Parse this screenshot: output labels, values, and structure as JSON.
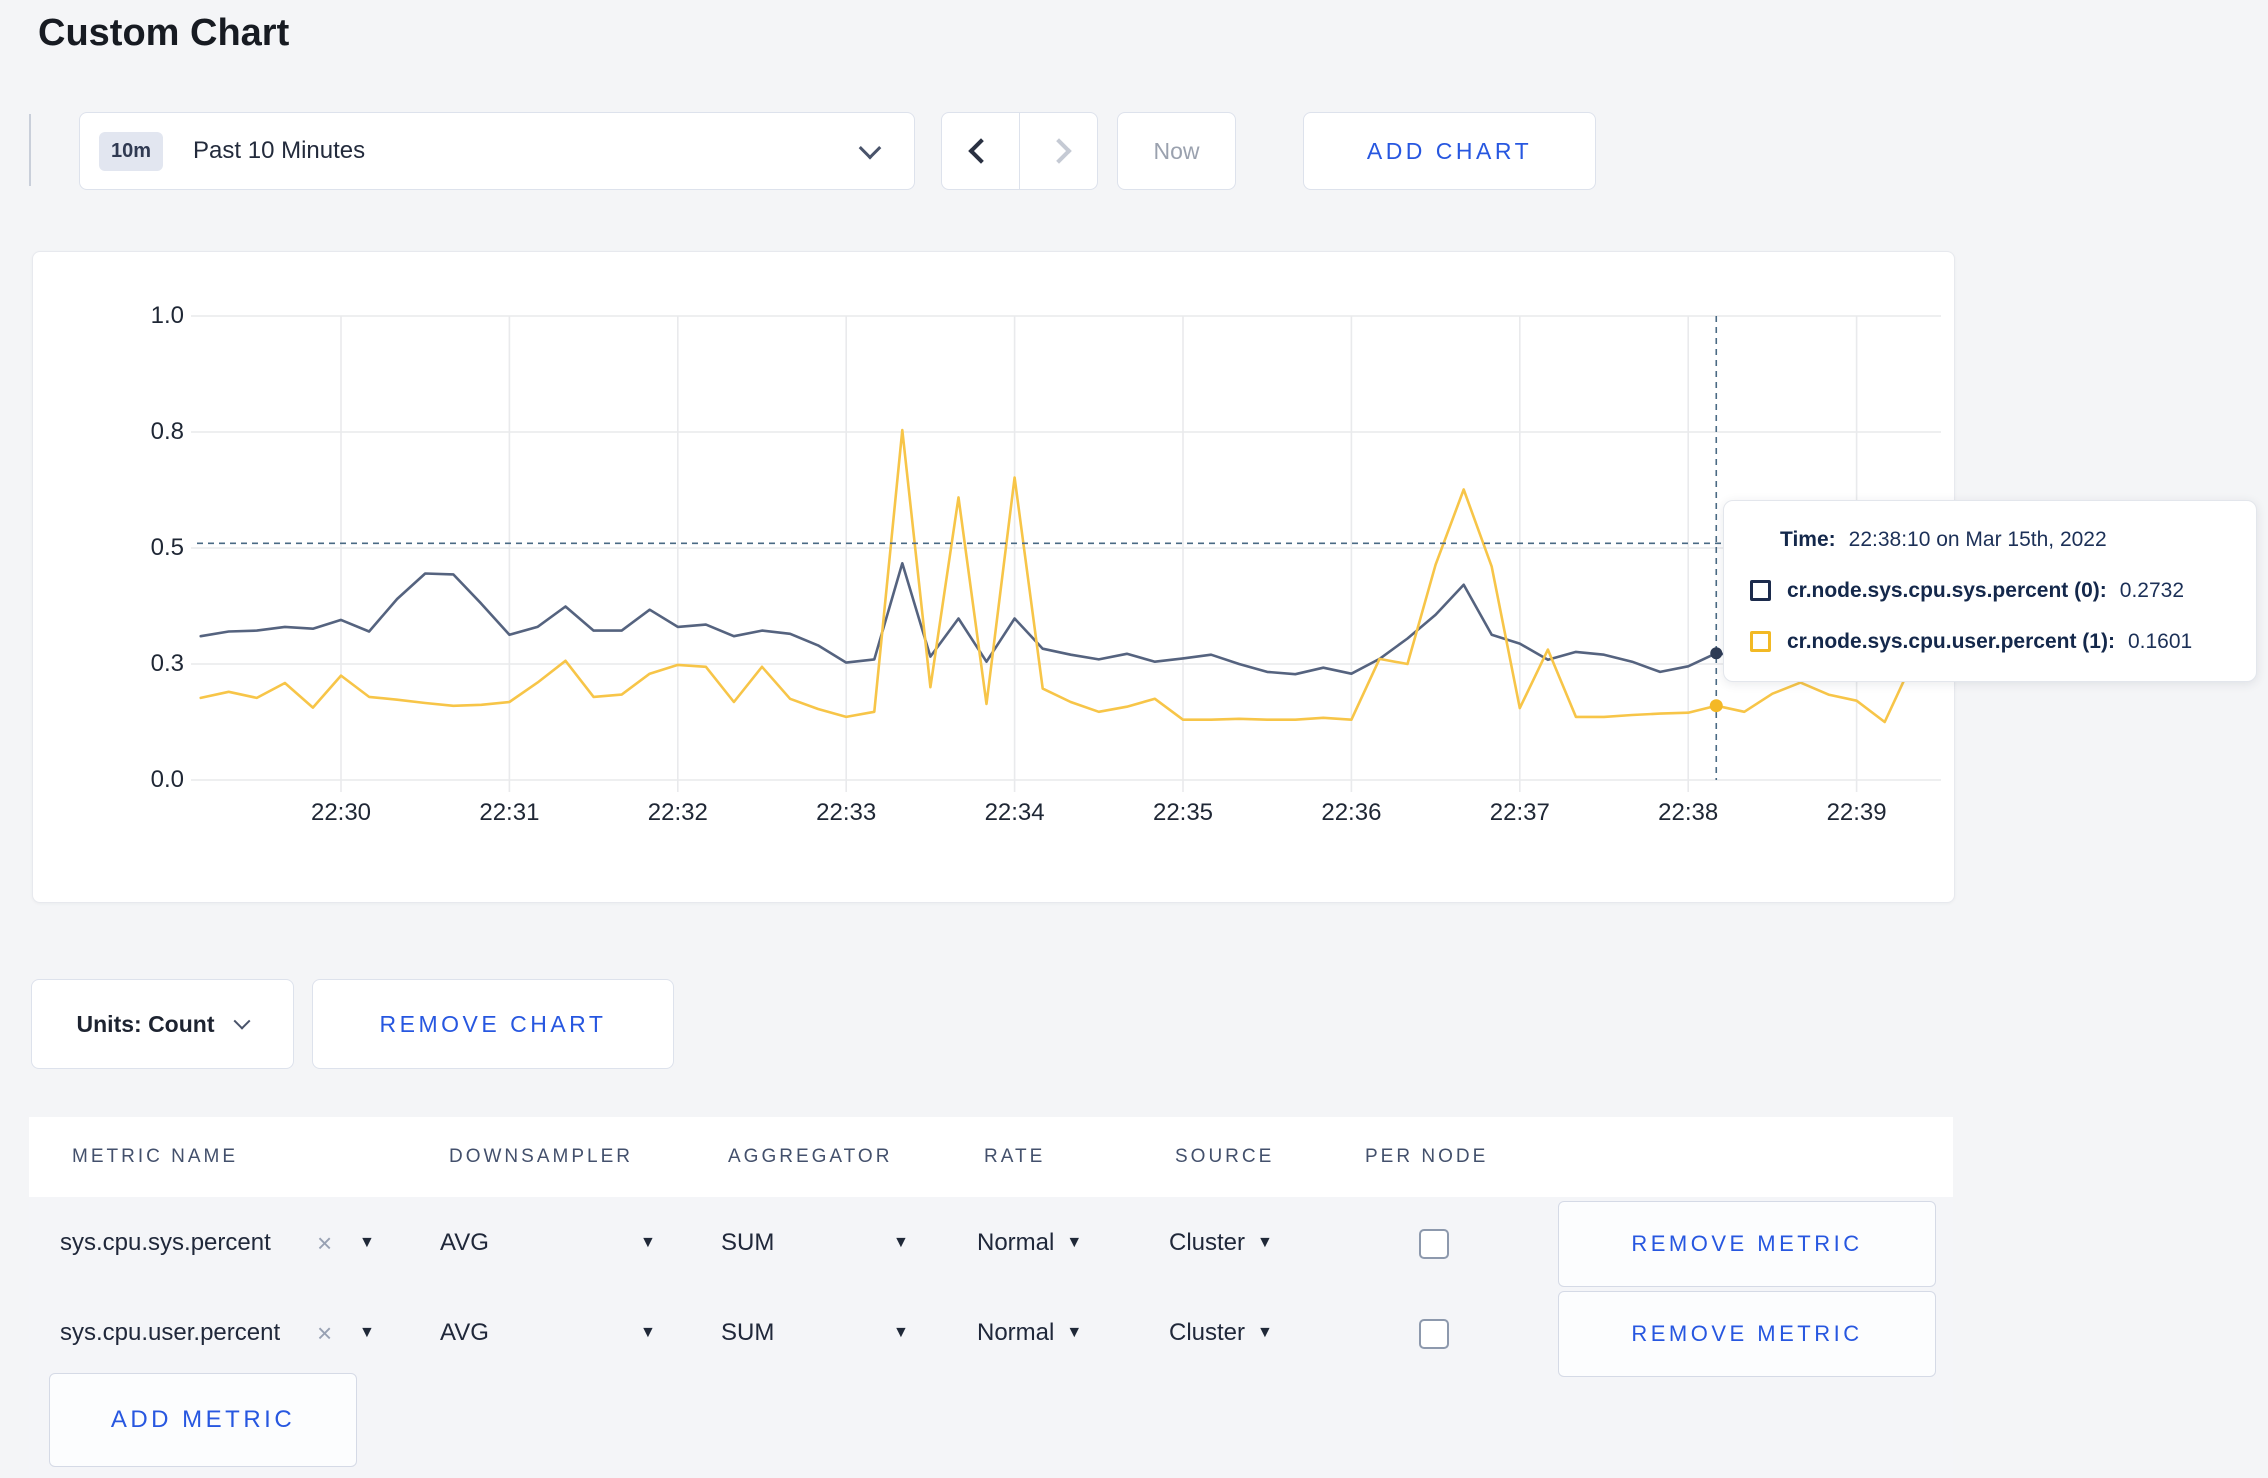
{
  "page": {
    "title": "Custom Chart",
    "accent_blue": "#2757e0",
    "background": "#f4f5f7"
  },
  "toolbar": {
    "time_window_badge": "10m",
    "time_window_label": "Past 10 Minutes",
    "now_label": "Now",
    "add_chart_label": "ADD CHART"
  },
  "chart_data": {
    "type": "line",
    "title": "",
    "xlabel": "",
    "ylabel": "",
    "ylim": [
      0,
      1
    ],
    "grid": true,
    "x_tick_labels": [
      "22:30",
      "22:31",
      "22:32",
      "22:33",
      "22:34",
      "22:35",
      "22:36",
      "22:37",
      "22:38",
      "22:39"
    ],
    "y_tick_labels": [
      "0.0",
      "0.3",
      "0.5",
      "0.8",
      "1.0"
    ],
    "y_tick_values": [
      0,
      0.25,
      0.5,
      0.75,
      1.0
    ],
    "x_start_seconds": -50,
    "x_step_seconds": 10,
    "series": [
      {
        "name": "cr.node.sys.cpu.sys.percent",
        "color": "#55637f",
        "values": [
          0.31,
          0.32,
          0.322,
          0.33,
          0.326,
          0.345,
          0.32,
          0.39,
          0.445,
          0.443,
          0.38,
          0.313,
          0.33,
          0.374,
          0.322,
          0.322,
          0.367,
          0.33,
          0.335,
          0.31,
          0.322,
          0.315,
          0.29,
          0.253,
          0.26,
          0.467,
          0.266,
          0.348,
          0.255,
          0.348,
          0.283,
          0.27,
          0.26,
          0.272,
          0.255,
          0.262,
          0.27,
          0.25,
          0.233,
          0.228,
          0.242,
          0.229,
          0.261,
          0.305,
          0.356,
          0.421,
          0.313,
          0.294,
          0.259,
          0.276,
          0.27,
          0.255,
          0.233,
          0.245,
          0.2732,
          0.266,
          0.255,
          0.26,
          0.268,
          0.272,
          0.265,
          0.27
        ]
      },
      {
        "name": "cr.node.sys.cpu.user.percent",
        "color": "#f7c548",
        "values": [
          0.177,
          0.19,
          0.177,
          0.209,
          0.156,
          0.225,
          0.179,
          0.173,
          0.166,
          0.16,
          0.162,
          0.168,
          0.21,
          0.257,
          0.179,
          0.184,
          0.229,
          0.248,
          0.244,
          0.168,
          0.244,
          0.175,
          0.153,
          0.136,
          0.147,
          0.754,
          0.2,
          0.609,
          0.164,
          0.652,
          0.197,
          0.168,
          0.147,
          0.158,
          0.175,
          0.13,
          0.13,
          0.132,
          0.13,
          0.13,
          0.134,
          0.13,
          0.261,
          0.25,
          0.464,
          0.626,
          0.46,
          0.155,
          0.281,
          0.136,
          0.136,
          0.14,
          0.143,
          0.145,
          0.1601,
          0.147,
          0.186,
          0.21,
          0.184,
          0.171,
          0.125,
          0.255
        ]
      }
    ],
    "cursor": {
      "x_seconds": 490,
      "line_value": 0.51,
      "series_values": [
        0.2732,
        0.1601
      ]
    },
    "legend_position": "tooltip"
  },
  "tooltip": {
    "time_label": "Time:",
    "time_value": "22:38:10 on Mar 15th, 2022",
    "series": [
      {
        "label": "cr.node.sys.cpu.sys.percent (0):",
        "value": "0.2732",
        "swatch_color": "#1c2b4c"
      },
      {
        "label": "cr.node.sys.cpu.user.percent (1):",
        "value": "0.1601",
        "swatch_color": "#f2b924"
      }
    ]
  },
  "chart_footer": {
    "units_label": "Units: Count",
    "remove_chart_label": "REMOVE CHART"
  },
  "metrics_table": {
    "headers": [
      "METRIC NAME",
      "DOWNSAMPLER",
      "AGGREGATOR",
      "RATE",
      "SOURCE",
      "PER NODE"
    ],
    "rows": [
      {
        "metric": "sys.cpu.sys.percent",
        "downsampler": "AVG",
        "aggregator": "SUM",
        "rate": "Normal",
        "source": "Cluster",
        "per_node_checked": false,
        "remove_label": "REMOVE METRIC"
      },
      {
        "metric": "sys.cpu.user.percent",
        "downsampler": "AVG",
        "aggregator": "SUM",
        "rate": "Normal",
        "source": "Cluster",
        "per_node_checked": false,
        "remove_label": "REMOVE METRIC"
      }
    ],
    "add_metric_label": "ADD METRIC"
  }
}
